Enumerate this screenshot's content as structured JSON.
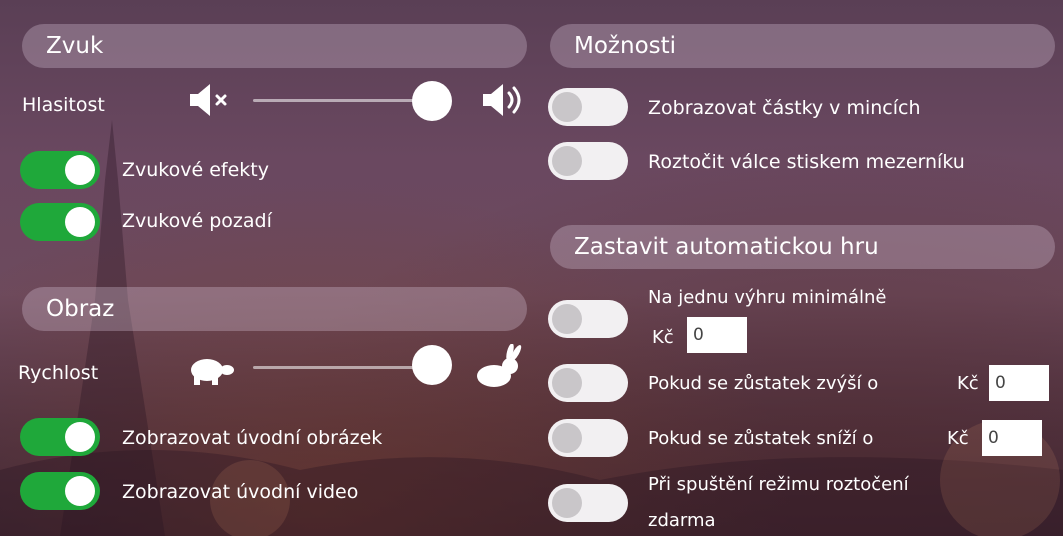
{
  "sound": {
    "title": "Zvuk",
    "volume_label": "Hlasitost",
    "volume_level": 0.92,
    "effects_label": "Zvukové efekty",
    "effects_on": true,
    "background_label": "Zvukové pozadí",
    "background_on": true,
    "mute_icon": "speaker-muted-icon",
    "loud_icon": "speaker-loud-icon"
  },
  "image": {
    "title": "Obraz",
    "speed_label": "Rychlost",
    "speed_level": 0.92,
    "intro_image_label": "Zobrazovat úvodní obrázek",
    "intro_image_on": true,
    "intro_video_label": "Zobrazovat úvodní video",
    "intro_video_on": true,
    "slow_icon": "turtle-icon",
    "fast_icon": "rabbit-icon"
  },
  "options": {
    "title": "Možnosti",
    "coins_label": "Zobrazovat částky v mincích",
    "coins_on": false,
    "spacebar_label": "Roztočit válce stiskem mezerníku",
    "spacebar_on": false
  },
  "autoplay": {
    "title": "Zastavit automatickou hru",
    "single_win_label": "Na jednu výhru minimálně",
    "single_win_currency": "Kč",
    "single_win_value": "0",
    "single_win_on": false,
    "balance_up_label": "Pokud se zůstatek zvýší o",
    "balance_up_currency": "Kč",
    "balance_up_value": "0",
    "balance_up_on": false,
    "balance_down_label": "Pokud se zůstatek sníží o",
    "balance_down_currency": "Kč",
    "balance_down_value": "0",
    "balance_down_on": false,
    "free_spins_label_1": "Při spuštění režimu roztočení",
    "free_spins_label_2": "zdarma",
    "free_spins_on": false
  },
  "colors": {
    "toggle_on": "#1fa83a",
    "toggle_off": "#f2f0f2"
  }
}
